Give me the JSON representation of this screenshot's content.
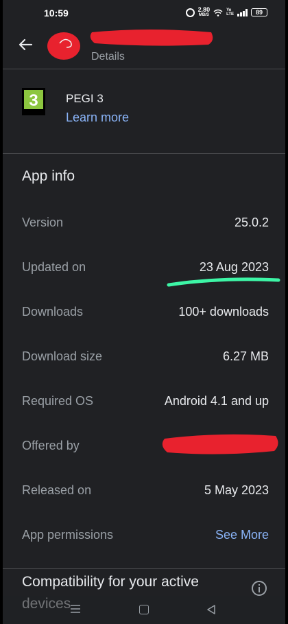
{
  "status_bar": {
    "time": "10:59",
    "net_speed_value": "2.80",
    "net_speed_unit": "MB/S",
    "volte_top": "Yo",
    "volte_bottom": "LTE",
    "battery": "89"
  },
  "header": {
    "subtitle": "Details"
  },
  "rating": {
    "badge_number": "3",
    "title": "PEGI 3",
    "link": "Learn more"
  },
  "app_info": {
    "heading": "App info",
    "rows": [
      {
        "label": "Version",
        "value": "25.0.2"
      },
      {
        "label": "Updated on",
        "value": "23 Aug 2023"
      },
      {
        "label": "Downloads",
        "value": "100+ downloads"
      },
      {
        "label": "Download size",
        "value": "6.27 MB"
      },
      {
        "label": "Required OS",
        "value": "Android 4.1 and up"
      },
      {
        "label": "Offered by",
        "value": ""
      },
      {
        "label": "Released on",
        "value": "5 May 2023"
      },
      {
        "label": "App permissions",
        "value": "See More"
      }
    ]
  },
  "compatibility": {
    "title": "Compatibility for your active devices"
  },
  "colors": {
    "background": "#202124",
    "link": "#8ab4f8",
    "redaction": "#e8222e",
    "highlight": "#3df5a6",
    "pegi_green": "#8cc63f"
  }
}
